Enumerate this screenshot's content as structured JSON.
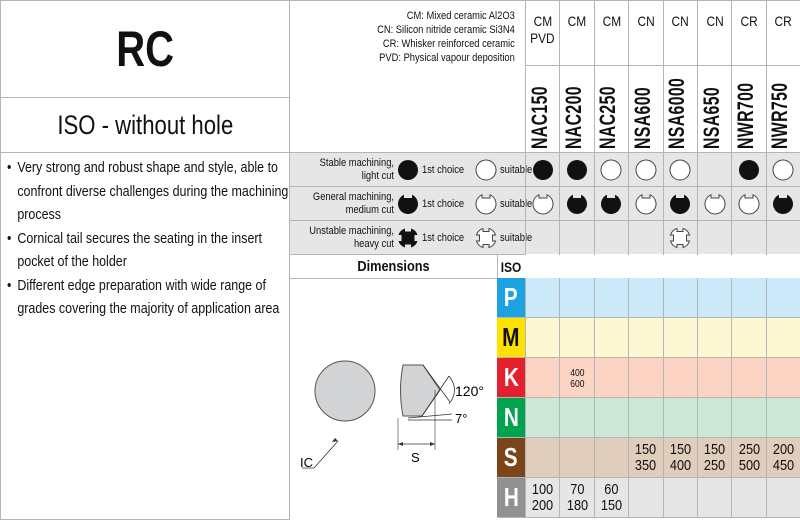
{
  "header": {
    "title": "RC",
    "subtitle": "ISO - without hole"
  },
  "features": [
    "Very strong and robust shape and style, able to confront diverse challenges during the machining process",
    "Cornical tail secures the seating in the insert pocket of the holder",
    "Different edge preparation with wide range of grades covering the majority of application area"
  ],
  "legend": [
    "CM: Mixed ceramic Al2O3",
    "CN: Silicon nitride ceramic Si3N4",
    "CR: Whisker reinforced ceramic",
    "PVD: Physical vapour deposition"
  ],
  "grades": [
    {
      "type": "CM",
      "type2": "PVD",
      "name": "NAC150"
    },
    {
      "type": "CM",
      "type2": "",
      "name": "NAC200"
    },
    {
      "type": "CM",
      "type2": "",
      "name": "NAC250"
    },
    {
      "type": "CN",
      "type2": "",
      "name": "NSA600"
    },
    {
      "type": "CN",
      "type2": "",
      "name": "NSA6000"
    },
    {
      "type": "CN",
      "type2": "",
      "name": "NSA650"
    },
    {
      "type": "CR",
      "type2": "",
      "name": "NWR700"
    },
    {
      "type": "CR",
      "type2": "",
      "name": "NWR750"
    }
  ],
  "machining": [
    {
      "label1": "Stable machining,",
      "label2": "light cut",
      "shape": "circle",
      "first": "1st choice",
      "suitable": "suitable",
      "values": [
        "full",
        "full",
        "open",
        "open",
        "open",
        "none",
        "full",
        "open"
      ]
    },
    {
      "label1": "General machining,",
      "label2": "medium cut",
      "shape": "notch",
      "first": "1st choice",
      "suitable": "suitable",
      "values": [
        "open",
        "full",
        "full",
        "open",
        "full",
        "open",
        "open",
        "full"
      ]
    },
    {
      "label1": "Unstable machining,",
      "label2": "heavy cut",
      "shape": "cross",
      "first": "1st choice",
      "suitable": "suitable",
      "values": [
        "none",
        "none",
        "none",
        "none",
        "open",
        "none",
        "none",
        "none"
      ]
    }
  ],
  "dimensions": {
    "title": "Dimensions",
    "ic": "IC",
    "s": "S",
    "angle1": "120°",
    "angle2": "7°"
  },
  "iso_header": "ISO",
  "iso": [
    {
      "letter": "P",
      "color": "#1aa3e0",
      "text": "#ffffff",
      "bg": "#cbe9f9",
      "values": [
        "",
        "",
        "",
        "",
        "",
        "",
        "",
        ""
      ]
    },
    {
      "letter": "M",
      "color": "#ffe100",
      "text": "#111111",
      "bg": "#fdf7d2",
      "values": [
        "",
        "",
        "",
        "",
        "",
        "",
        "",
        ""
      ]
    },
    {
      "letter": "K",
      "color": "#e5202e",
      "text": "#ffffff",
      "bg": "#fbd4c3",
      "values": [
        "",
        "400\n600",
        "",
        "",
        "",
        "",
        "",
        ""
      ],
      "small": true
    },
    {
      "letter": "N",
      "color": "#00a44f",
      "text": "#ffffff",
      "bg": "#cde8d6",
      "values": [
        "",
        "",
        "",
        "",
        "",
        "",
        "",
        ""
      ]
    },
    {
      "letter": "S",
      "color": "#7a4519",
      "text": "#ffffff",
      "bg": "#e0cdbc",
      "values": [
        "",
        "",
        "",
        "150\n350",
        "150\n400",
        "150\n250",
        "250\n500",
        "200\n450"
      ]
    },
    {
      "letter": "H",
      "color": "#8f9193",
      "text": "#ffffff",
      "bg": "#e6e6e6",
      "values": [
        "100\n200",
        "70\n180",
        "60\n150",
        "",
        "",
        "",
        "",
        ""
      ]
    }
  ]
}
